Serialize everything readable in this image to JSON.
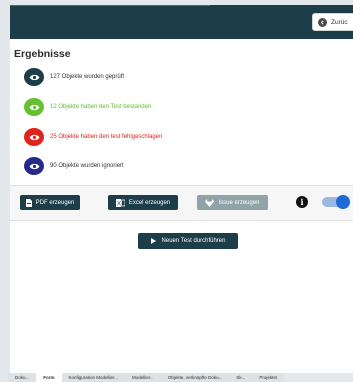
{
  "header": {
    "back_label": "Zurüc"
  },
  "page_title": "Ergebnisse",
  "results": [
    {
      "text": "127 Objekte wurden geprüft",
      "icon": "eye-icon",
      "icon_bg": "#1d3d48",
      "text_color": "#333333"
    },
    {
      "text": "12 Objekte haben den Test bestanden",
      "icon": "eye-icon",
      "icon_bg": "#63c132",
      "text_color": "#5fbf2a"
    },
    {
      "text": "25 Objekte haben den test fehlgeschlagen",
      "icon": "eye-icon",
      "icon_bg": "#e0231c",
      "text_color": "#e0231c"
    },
    {
      "text": "90 Objekte wurden ignoriert",
      "icon": "eye-icon",
      "icon_bg": "#262b8a",
      "text_color": "#333333"
    }
  ],
  "actions": {
    "pdf_label": "PDF erzeugen",
    "excel_label": "Excel erzeugen",
    "issue_label": "Issue erzeugen",
    "info_icon": "i"
  },
  "run_test_label": "Neuen Test durchführen",
  "bottom_tabs": [
    {
      "label": "Doku...",
      "active": false
    },
    {
      "label": "Form",
      "active": true
    },
    {
      "label": "Konfiguration Modellier...",
      "active": false
    },
    {
      "label": "Modellier...",
      "active": false
    },
    {
      "label": "Objekte, verknüpfte Doku...",
      "active": false
    },
    {
      "label": "Sk...",
      "active": false
    },
    {
      "label": "Projektst",
      "active": false
    }
  ],
  "colors": {
    "header_bg": "#1d3d48",
    "pdf_btn": "#1d3d48",
    "excel_btn": "#1d3d48",
    "issue_btn": "#8fa3a9",
    "toggle_on": "#1f6ad6"
  }
}
